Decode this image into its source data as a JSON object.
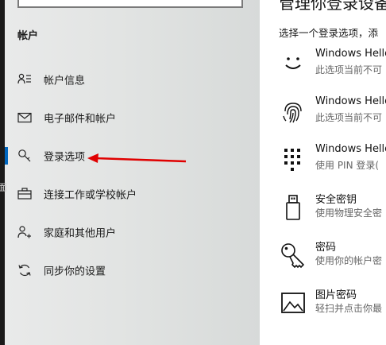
{
  "left": {
    "section_title": "帐户",
    "edge_char": "面",
    "nav_items": [
      {
        "label": "帐户信息",
        "icon": "person-info-icon",
        "active": false
      },
      {
        "label": "电子邮件和帐户",
        "icon": "mail-icon",
        "active": false
      },
      {
        "label": "登录选项",
        "icon": "key-icon",
        "active": true
      },
      {
        "label": "连接工作或学校帐户",
        "icon": "briefcase-icon",
        "active": false
      },
      {
        "label": "家庭和其他用户",
        "icon": "add-person-icon",
        "active": false
      },
      {
        "label": "同步你的设置",
        "icon": "sync-icon",
        "active": false
      }
    ]
  },
  "right": {
    "page_title": "管理你登录设备",
    "page_desc": "选择一个登录选项，添",
    "options": [
      {
        "title": "Windows Hello",
        "sub": "此选项当前不可",
        "icon": "face-icon"
      },
      {
        "title": "Windows Hello",
        "sub": "此选项当前不可",
        "icon": "fingerprint-icon"
      },
      {
        "title": "Windows Hello",
        "sub": "使用 PIN 登录(",
        "icon": "pin-keypad-icon"
      },
      {
        "title": "安全密钥",
        "sub": "使用物理安全密",
        "icon": "usb-key-icon"
      },
      {
        "title": "密码",
        "sub": "使用你的帐户密",
        "icon": "password-key-icon"
      },
      {
        "title": "图片密码",
        "sub": "轻扫并点击你最",
        "icon": "picture-icon"
      }
    ]
  },
  "colors": {
    "accent": "#0067c0",
    "annotation_arrow": "#e00000"
  }
}
